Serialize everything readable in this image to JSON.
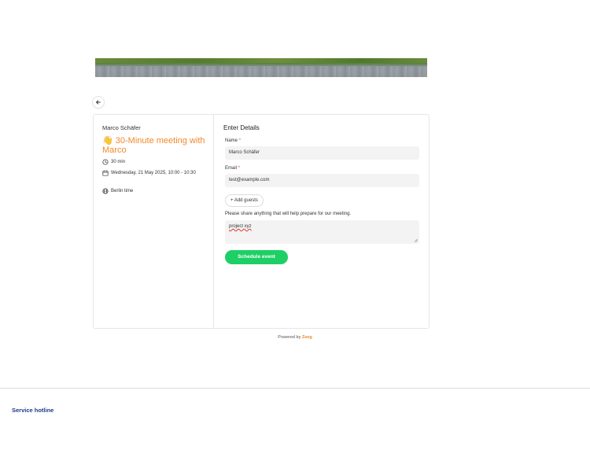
{
  "banner": {
    "alt": "landscape-banner"
  },
  "back": {
    "icon": "arrow-left-icon"
  },
  "event": {
    "organizer": "Marco Schäfer",
    "emoji": "👋",
    "title": "30-Minute meeting with Marco",
    "duration": "30 min",
    "datetime": "Wednesday, 21 May 2025, 10:00 - 10:30",
    "timezone": "Berlin time"
  },
  "form": {
    "heading": "Enter Details",
    "name_label": "Name",
    "name_value": "Marco Schäfer",
    "email_label": "Email",
    "email_value": "test@example.com",
    "required_mark": "*",
    "add_guests_label": "+ Add guests",
    "notes_label": "Please share anything that will help prepare for our meeting.",
    "notes_value": "project xyz",
    "submit_label": "Schedule event"
  },
  "footer": {
    "powered_by": "Powered by",
    "brand": "Zeeg",
    "service_hotline": "Service hotline"
  },
  "colors": {
    "accent": "#f18a2a",
    "submit": "#1dcf65",
    "link": "#1f3a8a"
  }
}
